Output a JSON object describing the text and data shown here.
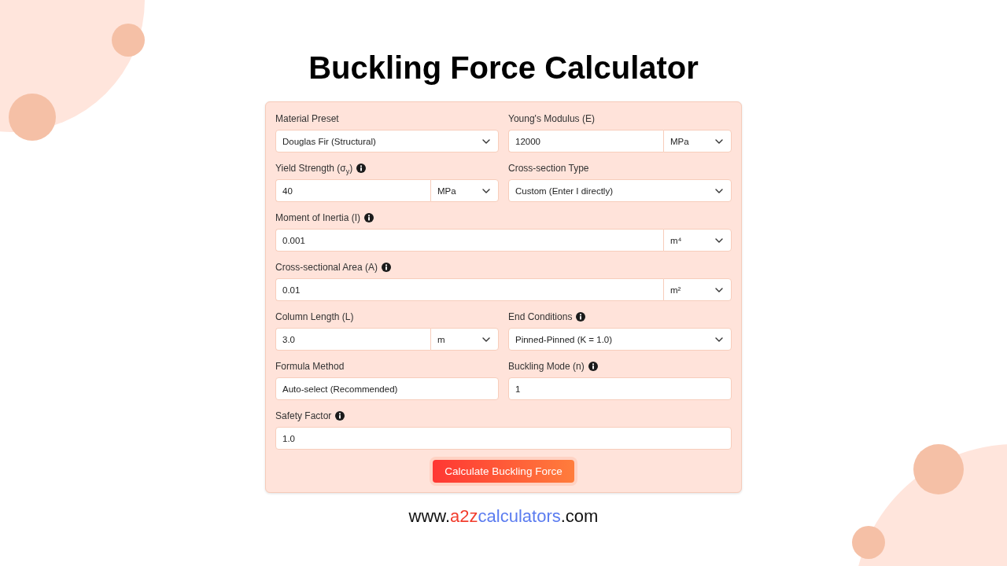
{
  "title": "Buckling Force Calculator",
  "form": {
    "rows": [
      {
        "fields": [
          {
            "label": "Material Preset",
            "info": false,
            "kind": "select",
            "value": "Douglas Fir (Structural)"
          },
          {
            "label": "Young's Modulus (E)",
            "info": false,
            "kind": "number_unit",
            "value": "12000",
            "unit": "MPa"
          }
        ]
      },
      {
        "fields": [
          {
            "label": "Yield Strength (σ$_{y}$)",
            "info": true,
            "kind": "number_unit",
            "value": "40",
            "unit": "MPa"
          },
          {
            "label": "Cross-section Type",
            "info": false,
            "kind": "select",
            "value": "Custom (Enter I directly)"
          }
        ]
      },
      {
        "fields": [
          {
            "label": "Moment of Inertia (I)",
            "info": true,
            "kind": "number_unit",
            "value": "0.001",
            "unit": "m⁴"
          }
        ]
      },
      {
        "fields": [
          {
            "label": "Cross-sectional Area (A)",
            "info": true,
            "kind": "number_unit",
            "value": "0.01",
            "unit": "m²"
          }
        ]
      },
      {
        "fields": [
          {
            "label": "Column Length (L)",
            "info": false,
            "kind": "number_unit",
            "value": "3.0",
            "unit": "m"
          },
          {
            "label": "End Conditions",
            "info": true,
            "kind": "select",
            "value": "Pinned-Pinned (K = 1.0)"
          }
        ]
      },
      {
        "fields": [
          {
            "label": "Formula Method",
            "info": false,
            "kind": "text",
            "value": "Auto-select (Recommended)"
          },
          {
            "label": "Buckling Mode (n)",
            "info": true,
            "kind": "text",
            "value": "1"
          }
        ]
      },
      {
        "fields": [
          {
            "label": "Safety Factor",
            "info": true,
            "kind": "text",
            "value": "1.0"
          }
        ]
      }
    ],
    "button": "Calculate Buckling Force"
  },
  "footer": {
    "segments": [
      {
        "text": "www.",
        "color": "#111111"
      },
      {
        "text": "a2z",
        "color": "#f23d2d"
      },
      {
        "text": "calculators",
        "color": "#5b7cf0"
      },
      {
        "text": ".com",
        "color": "#111111"
      }
    ]
  }
}
